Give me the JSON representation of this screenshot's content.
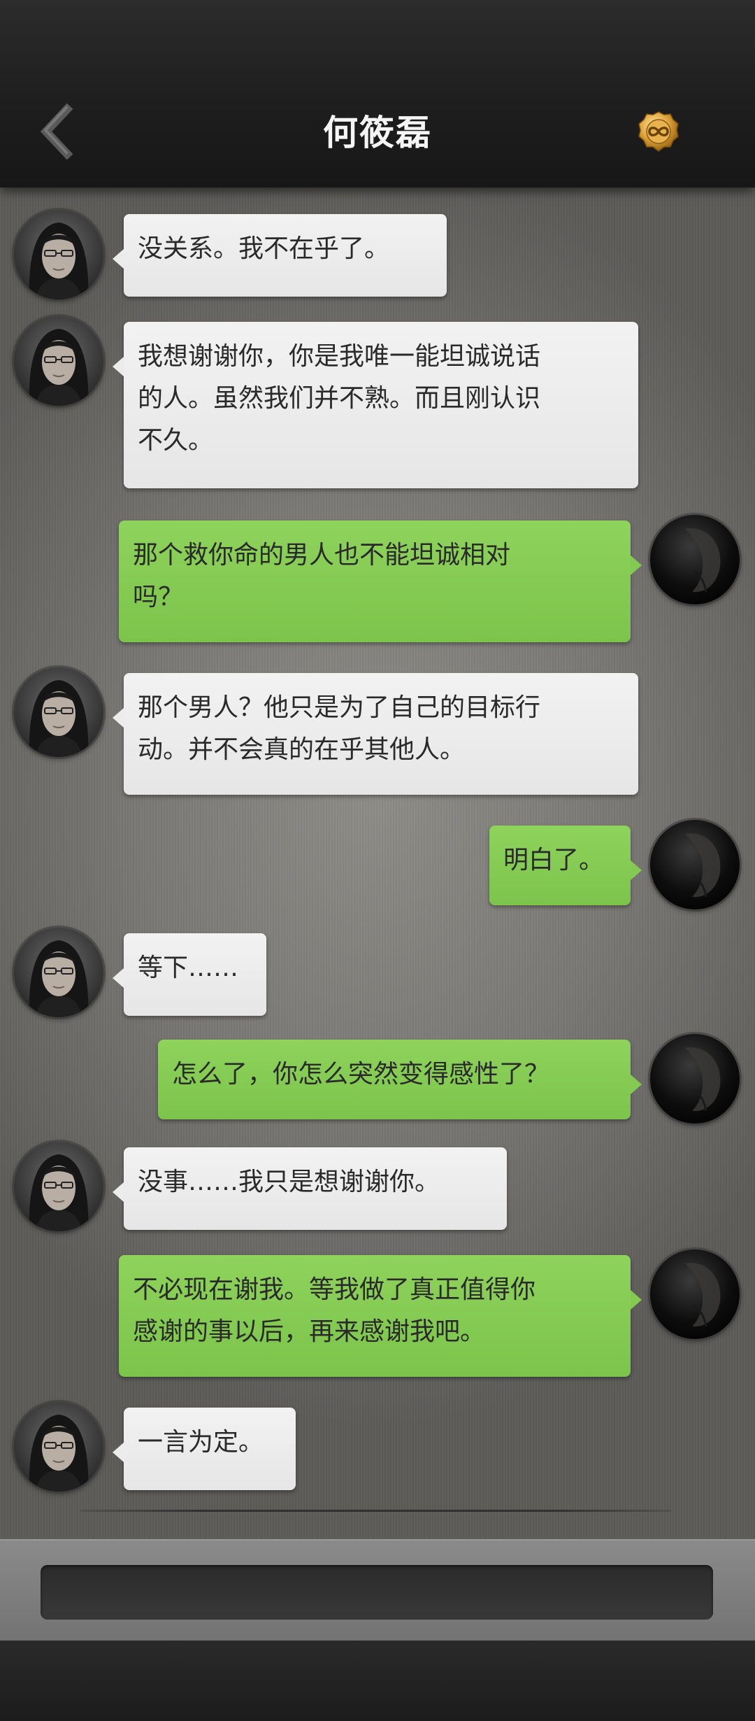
{
  "header": {
    "title": "何筱磊",
    "back_icon": "chevron-left-icon",
    "coin_icon": "infinity-coin-icon"
  },
  "colors": {
    "incoming_bubble": "#ececec",
    "outgoing_bubble": "#84ca52",
    "header_bg": "#1e1e1e"
  },
  "messages": [
    {
      "sender": "contact",
      "text": "没关系。我不在乎了。"
    },
    {
      "sender": "contact",
      "text": "我想谢谢你，你是我唯一能坦诚说话\n的人。虽然我们并不熟。而且刚认识\n不久。"
    },
    {
      "sender": "me",
      "text": "那个救你命的男人也不能坦诚相对\n吗？"
    },
    {
      "sender": "contact",
      "text": "那个男人？他只是为了自己的目标行\n动。并不会真的在乎其他人。"
    },
    {
      "sender": "me",
      "text": "明白了。"
    },
    {
      "sender": "contact",
      "text": "等下……"
    },
    {
      "sender": "me",
      "text": "怎么了，你怎么突然变得感性了？"
    },
    {
      "sender": "contact",
      "text": "没事……我只是想谢谢你。"
    },
    {
      "sender": "me",
      "text": "不必现在谢我。等我做了真正值得你\n感谢的事以后，再来感谢我吧。"
    },
    {
      "sender": "contact",
      "text": "一言为定。"
    }
  ],
  "input": {
    "placeholder": ""
  }
}
